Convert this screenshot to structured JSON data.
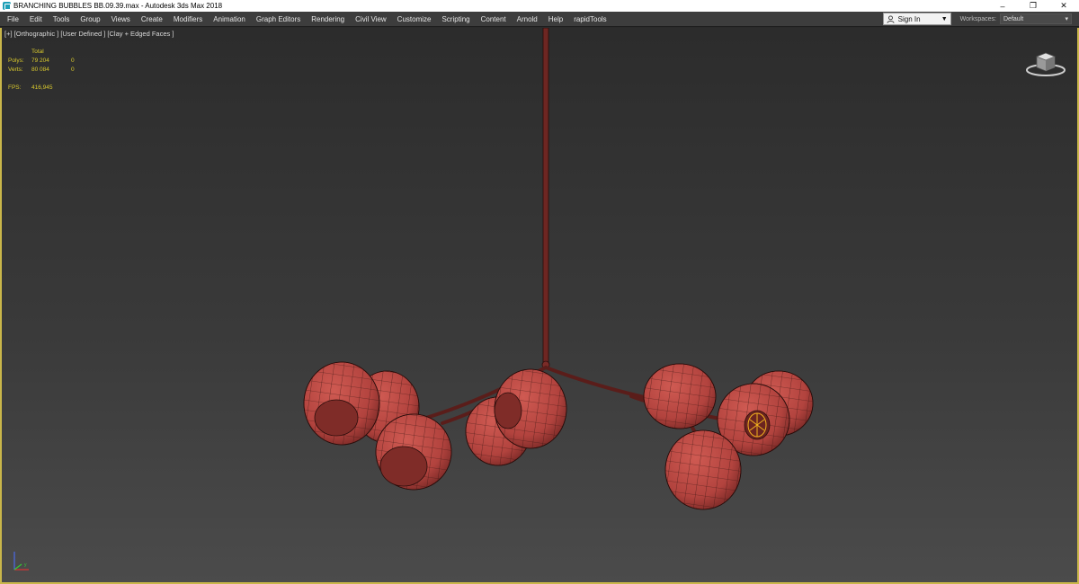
{
  "window": {
    "title": "BRANCHING BUBBLES BB.09.39.max - Autodesk 3ds Max 2018",
    "minimize": "–",
    "restore": "❐",
    "close": "✕"
  },
  "menu": {
    "items": [
      "File",
      "Edit",
      "Tools",
      "Group",
      "Views",
      "Create",
      "Modifiers",
      "Animation",
      "Graph Editors",
      "Rendering",
      "Civil View",
      "Customize",
      "Scripting",
      "Content",
      "Arnold",
      "Help",
      "rapidTools"
    ],
    "sign_in": "Sign In",
    "workspaces_label": "Workspaces:",
    "workspace_value": "Default"
  },
  "viewport": {
    "label": "[+] [Orthographic ] [User Defined ] [Clay + Edged Faces ]",
    "stats": {
      "header": "Total",
      "polys_label": "Polys:",
      "polys_total": "79 204",
      "polys_sel": "0",
      "verts_label": "Verts:",
      "verts_total": "80 084",
      "verts_sel": "0",
      "fps_label": "FPS:",
      "fps_value": "416,945"
    },
    "colors": {
      "accent_border": "#c9b64a",
      "stats_text": "#d8c82e",
      "shade_color": "#b84a45",
      "wire_color": "#3a1512"
    }
  },
  "icons": {
    "app": "3ds-max-icon",
    "user": "user-icon",
    "viewcube": "viewcube-icon",
    "axis": "axis-tripod-icon"
  }
}
